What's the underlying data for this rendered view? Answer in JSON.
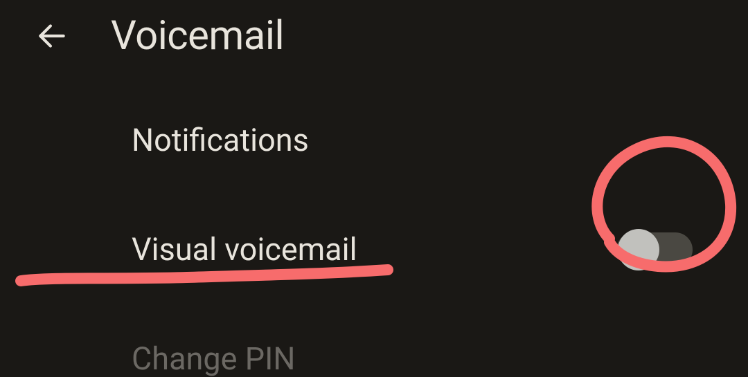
{
  "header": {
    "title": "Voicemail"
  },
  "settings": {
    "notifications": {
      "label": "Notifications"
    },
    "visual_voicemail": {
      "label": "Visual voicemail",
      "toggle_state": "off"
    },
    "change_pin": {
      "label": "Change PIN"
    }
  },
  "annotations": {
    "color": "#f76c6c"
  }
}
